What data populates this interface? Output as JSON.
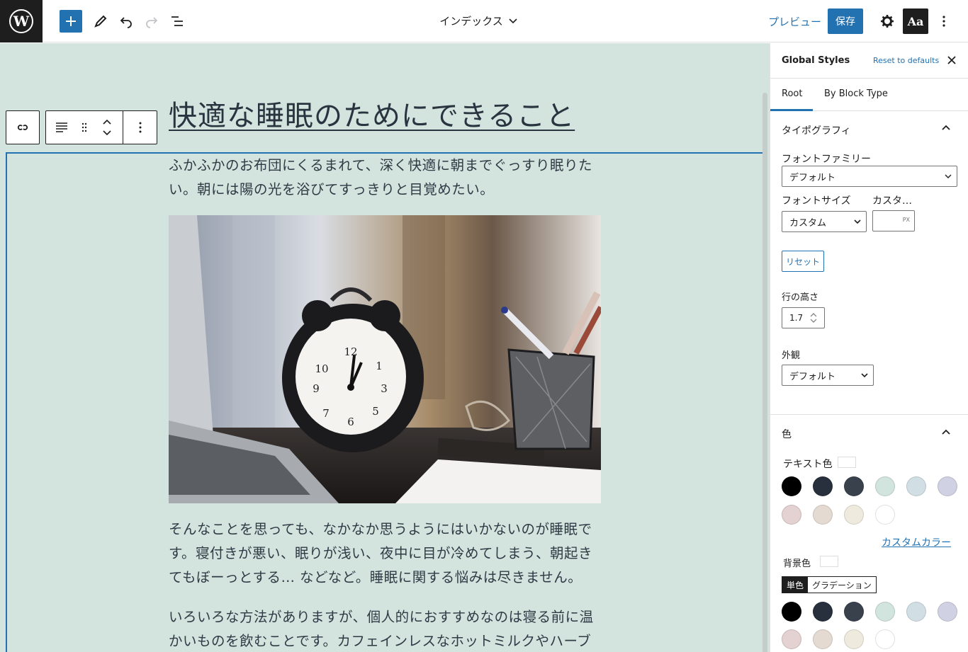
{
  "topbar": {
    "document_title": "インデックス",
    "preview_label": "プレビュー",
    "save_label": "保存",
    "styles_label": "Aa"
  },
  "post": {
    "title": "快適な睡眠のためにできること",
    "paragraphs": [
      "ふかふかのお布団にくるまれて、深く快適に朝までぐっすり眠りたい。朝には陽の光を浴びてすっきりと目覚めたい。",
      "そんなことを思っても、なかなか思うようにはいかないのが睡眠です。寝付きが悪い、眠りが浅い、夜中に目が冷めてしまう、朝起きてもぼーっとする… などなど。睡眠に関する悩みは尽きません。",
      "いろいろな方法がありますが、個人的におすすめなのは寝る前に温かいものを飲むことです。カフェインレスなホットミルクやハーブ"
    ]
  },
  "sidebar": {
    "title": "Global Styles",
    "reset_defaults": "Reset to defaults",
    "tabs": [
      "Root",
      "By Block Type"
    ],
    "typography": {
      "heading": "タイポグラフィ",
      "font_family_label": "フォントファミリー",
      "font_family_value": "デフォルト",
      "font_size_label": "フォントサイズ",
      "custom_label": "カスタ…",
      "font_size_value": "カスタム",
      "unit": "PX",
      "reset_label": "リセット",
      "line_height_label": "行の高さ",
      "line_height_value": "1.7",
      "appearance_label": "外観",
      "appearance_value": "デフォルト"
    },
    "color": {
      "heading": "色",
      "text_color_label": "テキスト色",
      "palette": [
        "#000000",
        "#28303d",
        "#39414d",
        "#d1e4dd",
        "#d1dfe4",
        "#d1d1e4",
        "#e4d1d1",
        "#e4dad1",
        "#eeeadd",
        "#ffffff"
      ],
      "custom_color_link": "カスタムカラー",
      "background_label": "背景色",
      "segments": [
        "単色",
        "グラデーション"
      ]
    }
  },
  "colors": {
    "accent": "#2271b1",
    "canvas_bg": "#d2e4dd"
  }
}
